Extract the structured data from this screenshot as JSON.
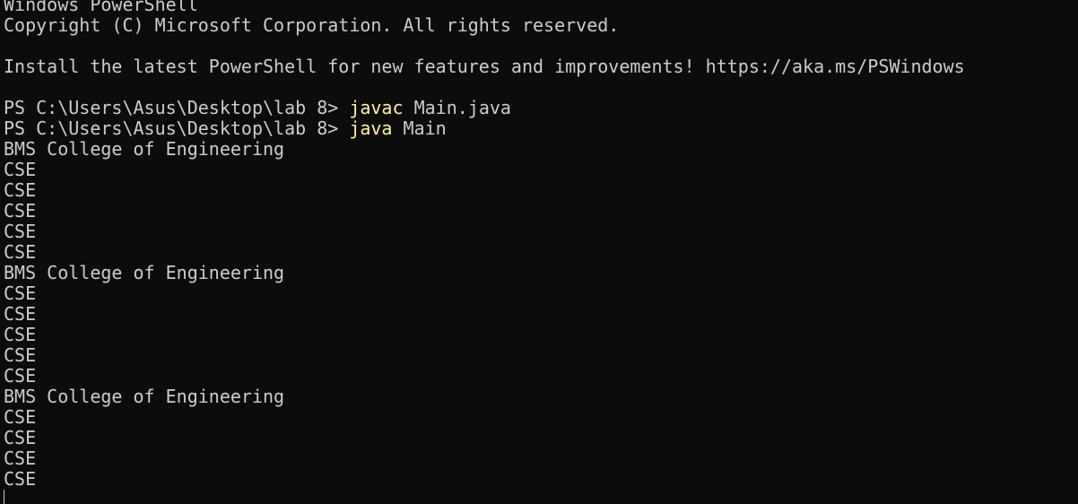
{
  "header": {
    "line1": "Windows PowerShell",
    "line2": "Copyright (C) Microsoft Corporation. All rights reserved.",
    "line3": "",
    "line4": "Install the latest PowerShell for new features and improvements! https://aka.ms/PSWindows",
    "line5": ""
  },
  "commands": [
    {
      "prompt": "PS C:\\Users\\Asus\\Desktop\\lab 8> ",
      "command": "javac",
      "args": " Main.java"
    },
    {
      "prompt": "PS C:\\Users\\Asus\\Desktop\\lab 8> ",
      "command": "java",
      "args": " Main"
    }
  ],
  "output": [
    "BMS College of Engineering",
    "CSE",
    "CSE",
    "CSE",
    "CSE",
    "CSE",
    "BMS College of Engineering",
    "CSE",
    "CSE",
    "CSE",
    "CSE",
    "CSE",
    "BMS College of Engineering",
    "CSE",
    "CSE",
    "CSE",
    "CSE"
  ],
  "colors": {
    "background": "#0c0c0c",
    "text": "#cccccc",
    "command": "#f9f1a5"
  }
}
